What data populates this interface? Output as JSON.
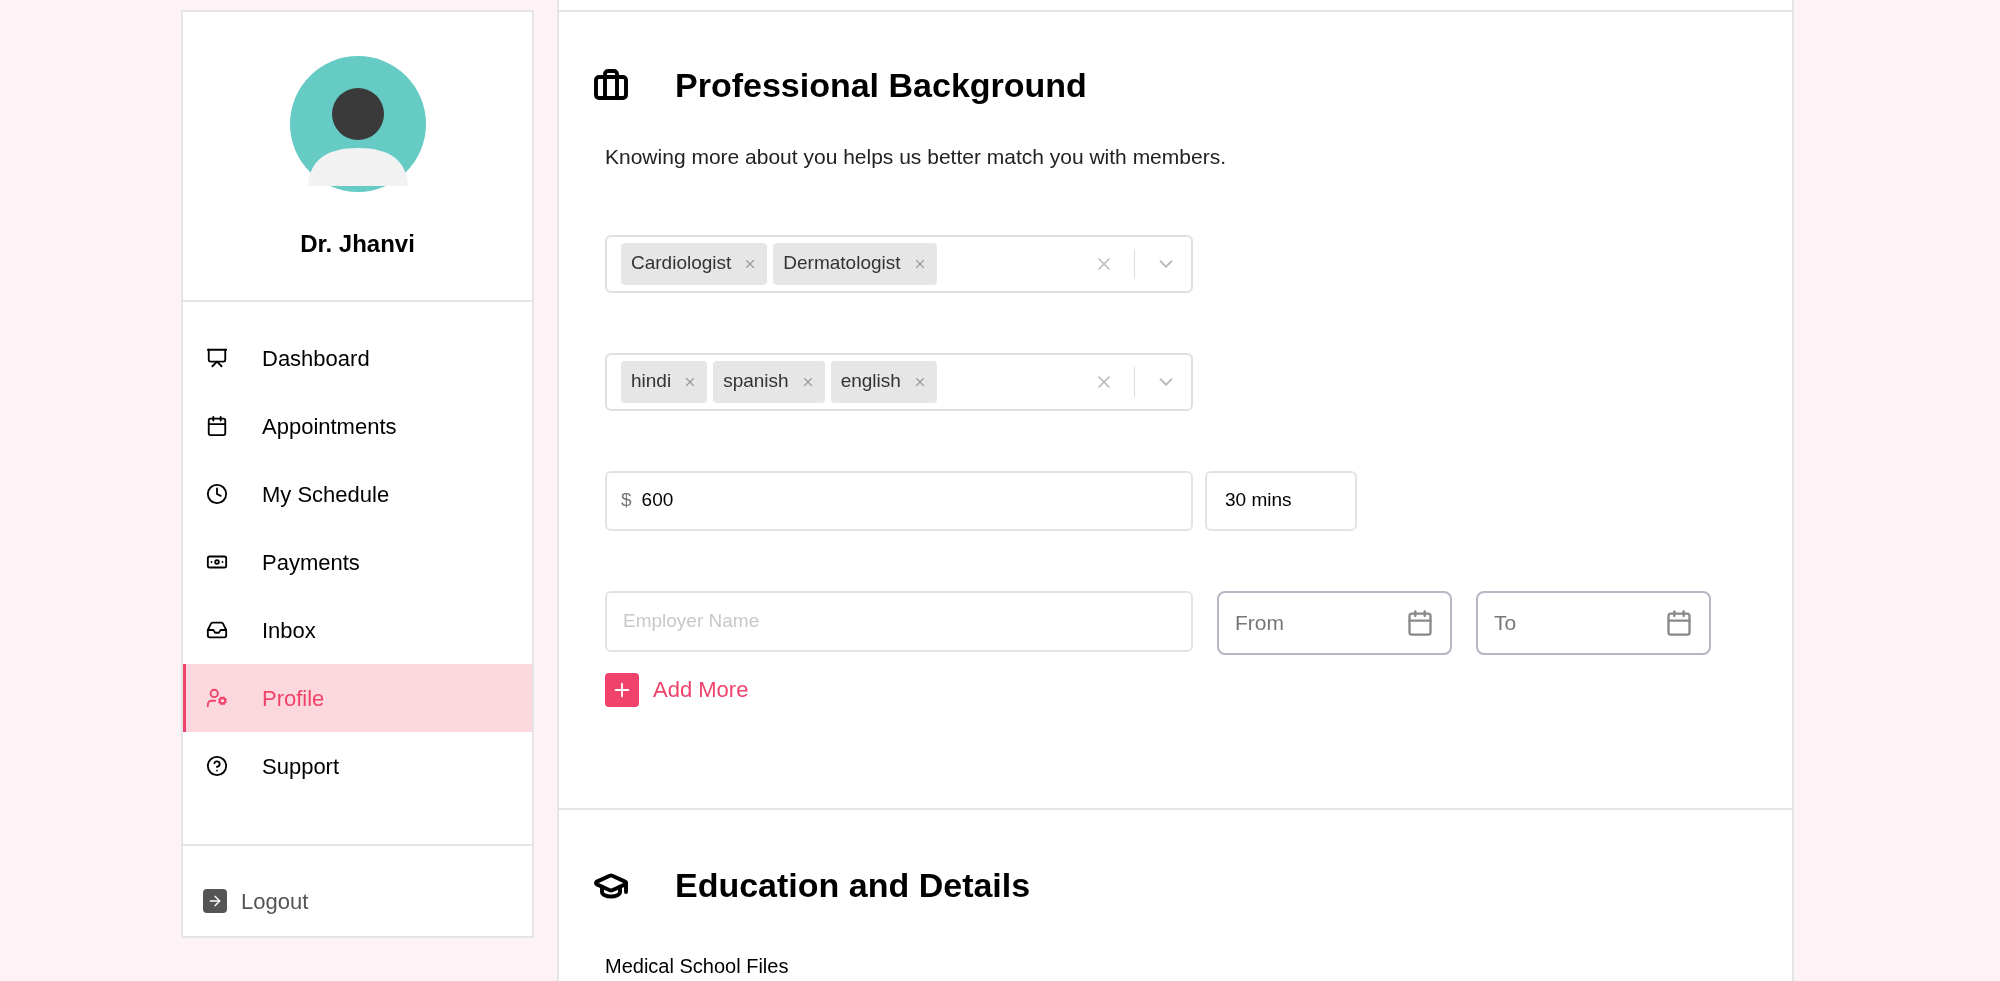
{
  "sidebar": {
    "user_name": "Dr. Jhanvi",
    "items": [
      {
        "label": "Dashboard",
        "kind": "dashboard",
        "selected": false
      },
      {
        "label": "Appointments",
        "kind": "calendar",
        "selected": false
      },
      {
        "label": "My Schedule",
        "kind": "clock",
        "selected": false
      },
      {
        "label": "Payments",
        "kind": "money",
        "selected": false
      },
      {
        "label": "Inbox",
        "kind": "inbox",
        "selected": false
      },
      {
        "label": "Profile",
        "kind": "profile",
        "selected": true
      },
      {
        "label": "Support",
        "kind": "help",
        "selected": false
      }
    ],
    "logout": "Logout"
  },
  "professional_background": {
    "title": "Professional Background",
    "description": "Knowing more about you helps us better match you with members.",
    "specialties": [
      "Cardiologist",
      "Dermatologist"
    ],
    "languages": [
      "hindi",
      "spanish",
      "english"
    ],
    "fee": {
      "currency": "$",
      "value": "600"
    },
    "duration": "30 mins",
    "employer": {
      "placeholder": "Employer Name"
    },
    "from": {
      "placeholder": "From"
    },
    "to": {
      "placeholder": "To"
    },
    "add_more": "Add More"
  },
  "education": {
    "title": "Education and Details",
    "files_label": "Medical School Files"
  }
}
